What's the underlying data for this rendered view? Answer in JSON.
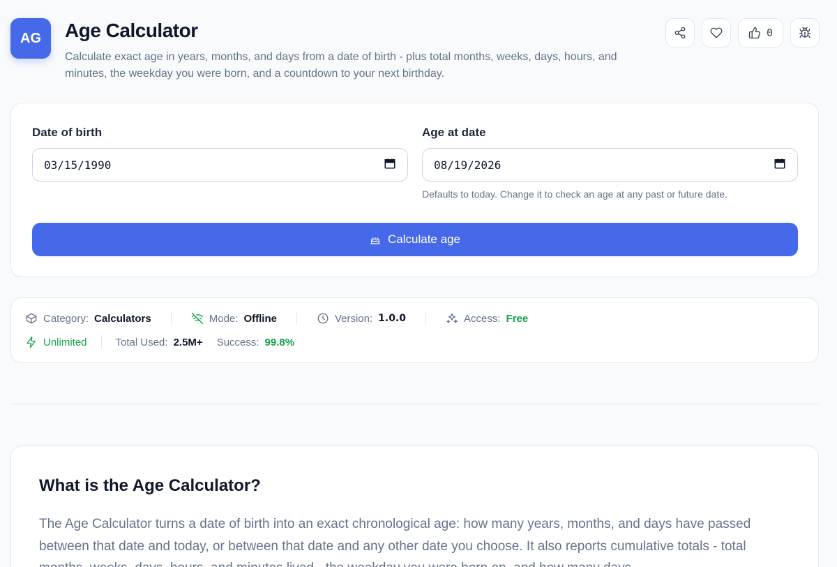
{
  "header": {
    "logo_text": "AG",
    "title": "Age Calculator",
    "description": "Calculate exact age in years, months, and days from a date of birth - plus total months, weeks, days, hours, and minutes, the weekday you were born, and a countdown to your next birthday.",
    "like_count": "0",
    "accent_color": "#4669ea"
  },
  "form": {
    "dob_label": "Date of birth",
    "dob_value": "03/15/1990",
    "age_at_label": "Age at date",
    "age_at_value": "08/19/2026",
    "age_at_hint": "Defaults to today. Change it to check an age at any past or future date.",
    "calculate_label": "Calculate age"
  },
  "meta": {
    "category_label": "Category:",
    "category_value": "Calculators",
    "mode_label": "Mode:",
    "mode_value": "Offline",
    "version_label": "Version:",
    "version_value": "1.0.0",
    "access_label": "Access:",
    "access_value": "Free",
    "unlimited_label": "Unlimited",
    "total_used_label": "Total Used:",
    "total_used_value": "2.5M+",
    "success_label": "Success:",
    "success_value": "99.8%",
    "success_color": "#16a34a"
  },
  "info": {
    "title": "What is the Age Calculator?",
    "text": "The Age Calculator turns a date of birth into an exact chronological age: how many years, months, and days have passed between that date and today, or between that date and any other date you choose. It also reports cumulative totals - total months, weeks, days, hours, and minutes lived - the weekday you were born on, and how many days"
  }
}
